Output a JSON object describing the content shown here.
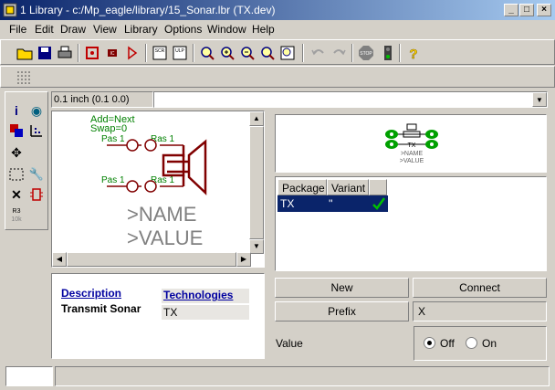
{
  "window": {
    "title": "1 Library - c:/Mp_eagle/library/15_Sonar.lbr (TX.dev)"
  },
  "menu": [
    "File",
    "Edit",
    "Draw",
    "View",
    "Library",
    "Options",
    "Window",
    "Help"
  ],
  "coord": "0.1 inch (0.1 0.0)",
  "command": "",
  "symbol": {
    "attr1": "Add=Next",
    "attr2": "Swap=0",
    "pin_tl": "Pas 1",
    "pin_tr": "Ras 1",
    "pin_bl": "Pas 1",
    "pin_br": "Ras 1",
    "name": ">NAME",
    "value": ">VALUE"
  },
  "description": {
    "label": "Description",
    "text": "Transmit Sonar",
    "tech_label": "Technologies",
    "tech_value": "TX"
  },
  "preview": {
    "pkg": "TX",
    "name": ">NAME",
    "value": ">VALUE"
  },
  "table": {
    "headers": [
      "Package",
      "Variant"
    ],
    "rows": [
      {
        "package": "TX",
        "variant": "''"
      }
    ]
  },
  "buttons": {
    "new": "New",
    "connect": "Connect",
    "prefix": "Prefix"
  },
  "prefix_value": "X",
  "value_opt": {
    "label": "Value",
    "off": "Off",
    "on": "On",
    "selected": "Off"
  },
  "colors": {
    "title": "#0a246a",
    "symbol": "#800000",
    "pins": "#008000",
    "text": "#808080"
  }
}
